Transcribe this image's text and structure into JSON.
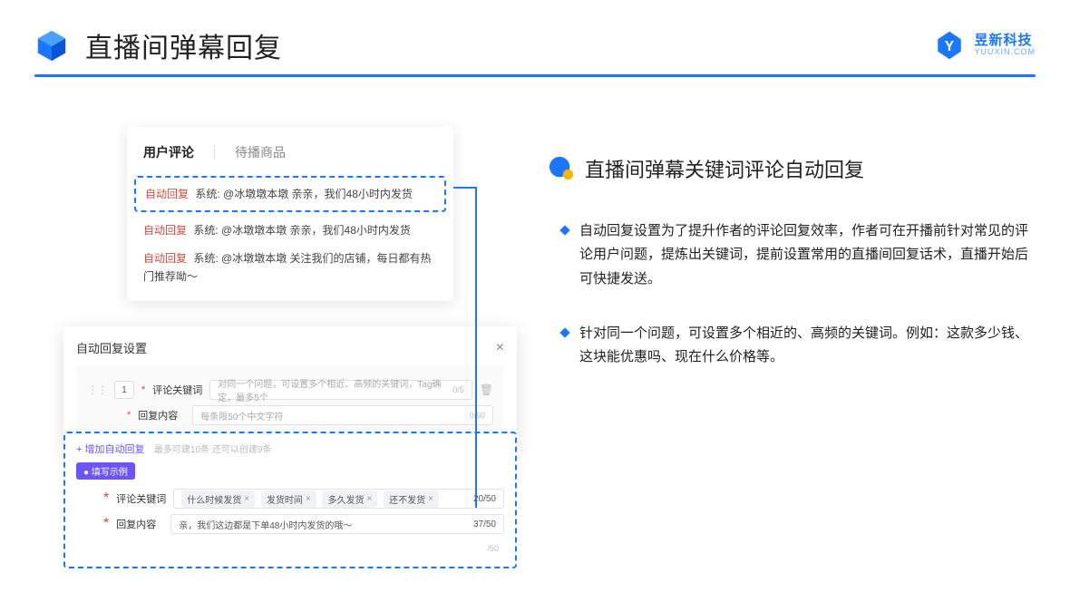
{
  "header": {
    "title": "直播间弹幕回复",
    "brand_cn": "昱新科技",
    "brand_en": "YUUXIN.COM"
  },
  "sub": {
    "title": "直播间弹幕关键词评论自动回复"
  },
  "bullets": [
    "自动回复设置为了提升作者的评论回复效率，作者可在开播前针对常见的评论用户问题，提炼出关键词，提前设置常用的直播间回复话术，直播开始后可快捷发送。",
    "针对同一个问题，可设置多个相近的、高频的关键词。例如：这款多少钱、这块能优惠吗、现在什么价格等。"
  ],
  "comments": {
    "tabs": {
      "active": "用户评论",
      "other": "待播商品"
    },
    "rows": [
      {
        "tag": "自动回复",
        "text": "系统: @冰墩墩本墩 亲亲，我们48小时内发货"
      },
      {
        "tag": "自动回复",
        "text": "系统: @冰墩墩本墩 亲亲，我们48小时内发货"
      },
      {
        "tag": "自动回复",
        "text": "系统: @冰墩墩本墩 关注我们的店铺，每日都有热门推荐呦～"
      }
    ]
  },
  "settings": {
    "title": "自动回复设置",
    "num": "1",
    "kw_label": "评论关键词",
    "kw_placeholder": "对同一个问题，可设置多个相近、高频的关键词，Tag确定，最多5个",
    "kw_count": "0/5",
    "content_label": "回复内容",
    "content_placeholder": "每条限50个中文字符",
    "content_count": "0/50"
  },
  "example": {
    "add_link": "+ 增加自动回复",
    "add_hint": "最多可建10条 还可以创建9条",
    "pill": "● 填写示例",
    "kw_label": "评论关键词",
    "tags": [
      "什么时候发货",
      "发货时间",
      "多久发货",
      "还不发货"
    ],
    "kw_count": "20/50",
    "content_label": "回复内容",
    "content_value": "亲，我们这边都是下单48小时内发货的哦～",
    "content_count": "37/50",
    "outer_count": "/50"
  }
}
